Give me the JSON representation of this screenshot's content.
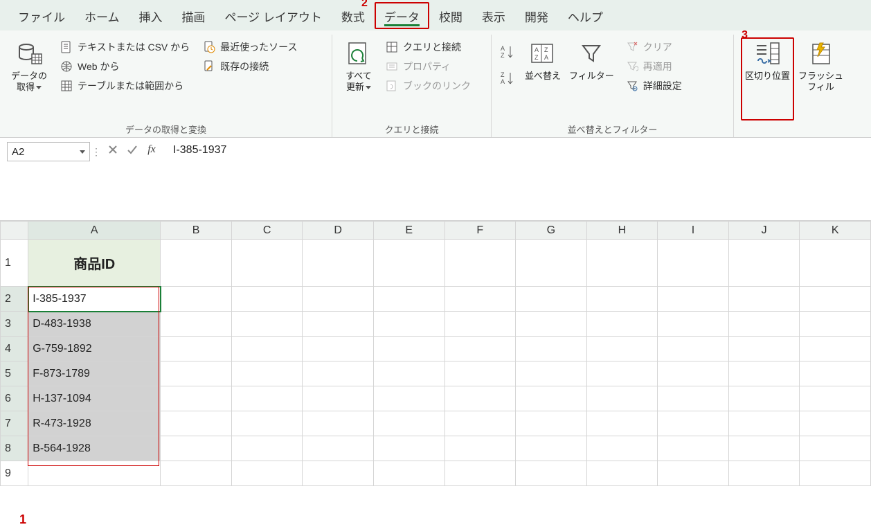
{
  "tabs": {
    "file": "ファイル",
    "home": "ホーム",
    "insert": "挿入",
    "draw": "描画",
    "pagelayout": "ページ レイアウト",
    "formulas": "数式",
    "data": "データ",
    "review": "校閲",
    "view": "表示",
    "developer": "開発",
    "help": "ヘルプ"
  },
  "annot": {
    "one": "1",
    "two": "2",
    "three": "3"
  },
  "ribbon": {
    "get_transform": {
      "get_data_l1": "データの",
      "get_data_l2": "取得",
      "from_text_csv": "テキストまたは CSV から",
      "from_web": "Web から",
      "from_table": "テーブルまたは範囲から",
      "recent": "最近使ったソース",
      "existing": "既存の接続",
      "label": "データの取得と変換"
    },
    "queries": {
      "refresh_l1": "すべて",
      "refresh_l2": "更新",
      "queries_conn": "クエリと接続",
      "properties": "プロパティ",
      "book_links": "ブックのリンク",
      "label": "クエリと接続"
    },
    "sort_filter": {
      "sort": "並べ替え",
      "filter": "フィルター",
      "clear": "クリア",
      "reapply": "再適用",
      "advanced": "詳細設定",
      "label": "並べ替えとフィルター"
    },
    "data_tools": {
      "text_to_cols": "区切り位置",
      "flash_fill_l1": "フラッシュ",
      "flash_fill_l2": "フィル"
    }
  },
  "formula_bar": {
    "name_box": "A2",
    "fx": "fx",
    "value": "I-385-1937"
  },
  "columns": [
    "A",
    "B",
    "C",
    "D",
    "E",
    "F",
    "G",
    "H",
    "I",
    "J",
    "K"
  ],
  "rows": [
    {
      "n": "1",
      "a": "商品ID",
      "header": true
    },
    {
      "n": "2",
      "a": "I-385-1937"
    },
    {
      "n": "3",
      "a": "D-483-1938"
    },
    {
      "n": "4",
      "a": "G-759-1892"
    },
    {
      "n": "5",
      "a": "F-873-1789"
    },
    {
      "n": "6",
      "a": "H-137-1094"
    },
    {
      "n": "7",
      "a": "R-473-1928"
    },
    {
      "n": "8",
      "a": "B-564-1928"
    },
    {
      "n": "9",
      "a": ""
    }
  ]
}
